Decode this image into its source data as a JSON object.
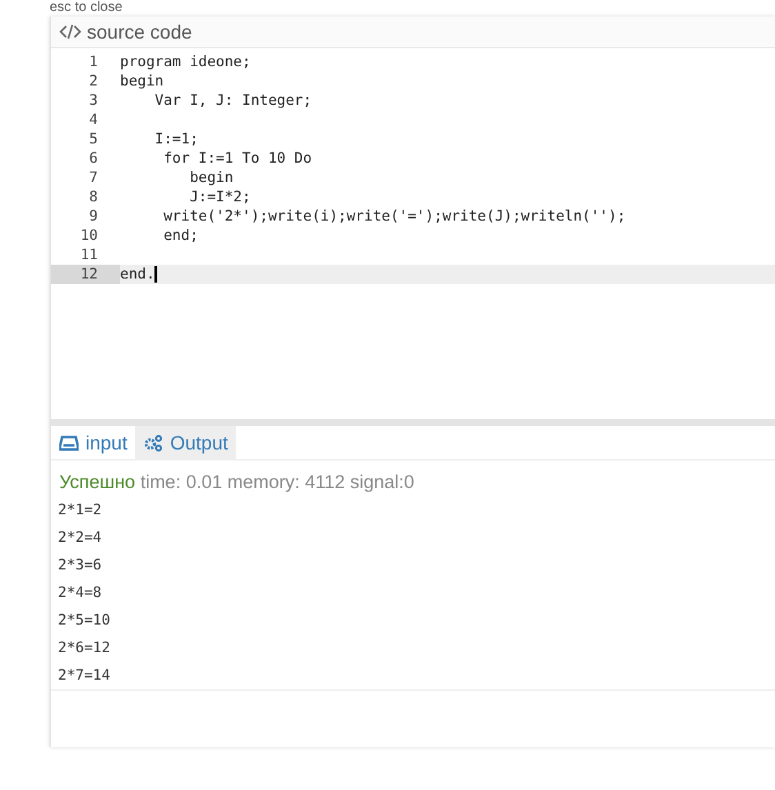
{
  "hint": "esc to close",
  "source": {
    "title": "source code",
    "lines": [
      {
        "number": "1",
        "text": "program ideone;",
        "current": false
      },
      {
        "number": "2",
        "text": "begin",
        "current": false
      },
      {
        "number": "3",
        "text": "    Var I, J: Integer;",
        "current": false
      },
      {
        "number": "4",
        "current": false
      },
      {
        "number": "5",
        "text": "    I:=1;",
        "current": false
      },
      {
        "number": "6",
        "text": "     for I:=1 To 10 Do",
        "current": false
      },
      {
        "number": "7",
        "text": "        begin",
        "current": false
      },
      {
        "number": "8",
        "text": "        J:=I*2;",
        "current": false
      },
      {
        "number": "9",
        "text": "     write('2*');write(i);write('=');write(J);writeln('');",
        "current": false
      },
      {
        "number": "10",
        "text": "     end;",
        "current": false
      },
      {
        "number": "11",
        "current": false
      },
      {
        "number": "12",
        "text": "end.",
        "current": true
      }
    ]
  },
  "tabs": [
    {
      "label": "input",
      "kind": "input",
      "selected": false
    },
    {
      "label": "Output",
      "kind": "output",
      "selected": true
    }
  ],
  "status": {
    "result": "Успешно",
    "details": "time: 0.01 memory: 4112 signal:0"
  },
  "output": [
    "2*1=2",
    "2*2=4",
    "2*3=6",
    "2*4=8",
    "2*5=10",
    "2*6=12",
    "2*7=14"
  ]
}
